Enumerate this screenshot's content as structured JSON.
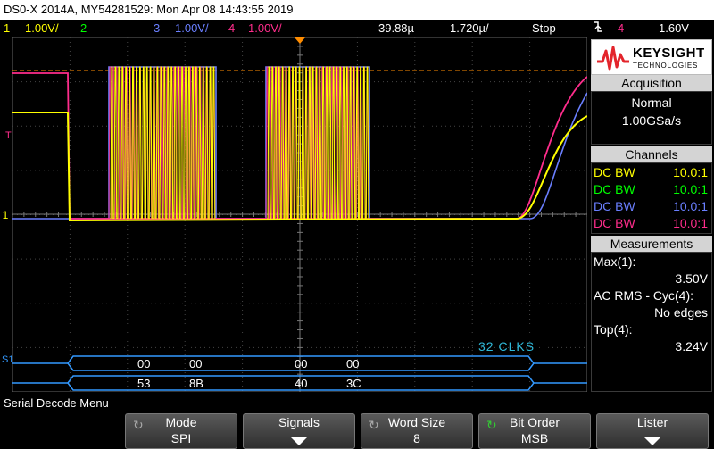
{
  "title": "DS0-X 2014A, MY54281529: Mon Apr 08 14:43:55 2019",
  "topbar": {
    "ch1_num": "1",
    "ch1_scale": "1.00V/",
    "ch2_num": "2",
    "ch3_num": "3",
    "ch3_scale": "1.00V/",
    "ch4_num": "4",
    "ch4_scale": "1.00V/",
    "time_delay": "39.88µ",
    "time_scale": "1.720µ/",
    "run_state": "Stop",
    "trigger_icon": "edge-falling-icon",
    "trig_ch": "4",
    "trig_level": "1.60V"
  },
  "colors": {
    "ch1": "#ffff00",
    "ch2": "#00ff00",
    "ch3": "#6a7fff",
    "ch4": "#ff2d8c",
    "decode": "#3399ff",
    "trigger": "#ff8c00"
  },
  "screen": {
    "ch1_marker": "1",
    "trig_marker": "T",
    "decode_marker": "S1",
    "clks_label": "32 CLKS",
    "decode_row1": [
      "00",
      "00",
      "00",
      "00"
    ],
    "decode_row2": [
      "53",
      "8B",
      "40",
      "3C"
    ]
  },
  "logo": {
    "line1": "KEYSIGHT",
    "line2": "TECHNOLOGIES"
  },
  "acquisition": {
    "header": "Acquisition",
    "mode": "Normal",
    "rate": "1.00GSa/s"
  },
  "channels": {
    "header": "Channels",
    "rows": [
      {
        "label": "DC BW",
        "value": "10.0:1"
      },
      {
        "label": "DC BW",
        "value": "10.0:1"
      },
      {
        "label": "DC BW",
        "value": "10.0:1"
      },
      {
        "label": "DC BW",
        "value": "10.0:1"
      }
    ]
  },
  "measurements": {
    "header": "Measurements",
    "m1_label": "Max(1):",
    "m1_value": "3.50V",
    "m2_label": "AC RMS - Cyc(4):",
    "m2_value": "No edges",
    "m3_label": "Top(4):",
    "m3_value": "3.24V"
  },
  "status_text": "Serial Decode Menu",
  "softkeys": [
    {
      "title": "Mode",
      "value": "SPI"
    },
    {
      "title": "Signals",
      "value": ""
    },
    {
      "title": "Word Size",
      "value": "8"
    },
    {
      "title": "Bit Order",
      "value": "MSB"
    },
    {
      "title": "Lister",
      "value": ""
    }
  ]
}
